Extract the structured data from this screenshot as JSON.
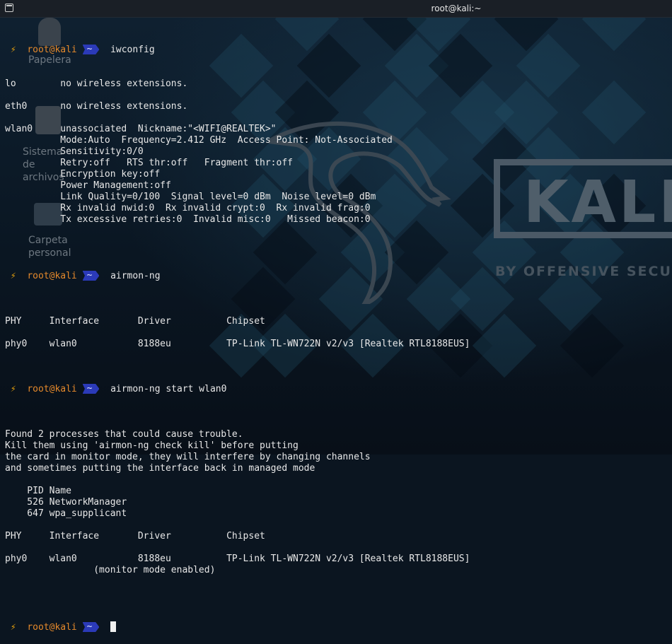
{
  "window": {
    "title": "root@kali:~",
    "icon": "terminal-icon"
  },
  "desktop": {
    "logo_text": "KALI",
    "logo_tagline": "BY OFFENSIVE SECURITY",
    "icons": [
      {
        "label": "Papelera",
        "icon": "trash-icon"
      },
      {
        "label": "Sistema de archivos",
        "icon": "drive-icon"
      },
      {
        "label": "Carpeta personal",
        "icon": "home-icon"
      }
    ]
  },
  "prompt": {
    "bolt": "⚡",
    "user": "root@kali",
    "cwd": "~"
  },
  "session": {
    "cmd1": "iwconfig",
    "iwconfig": [
      "lo        no wireless extensions.",
      "",
      "eth0      no wireless extensions.",
      "",
      "wlan0     unassociated  Nickname:\"<WIFI@REALTEK>\"",
      "          Mode:Auto  Frequency=2.412 GHz  Access Point: Not-Associated",
      "          Sensitivity:0/0",
      "          Retry:off   RTS thr:off   Fragment thr:off",
      "          Encryption key:off",
      "          Power Management:off",
      "          Link Quality=0/100  Signal level=0 dBm  Noise level=0 dBm",
      "          Rx invalid nwid:0  Rx invalid crypt:0  Rx invalid frag:0",
      "          Tx excessive retries:0  Invalid misc:0   Missed beacon:0",
      ""
    ],
    "cmd2": "airmon-ng",
    "airmon": [
      "",
      "PHY     Interface       Driver          Chipset",
      "",
      "phy0    wlan0           8188eu          TP-Link TL-WN722N v2/v3 [Realtek RTL8188EUS]"
    ],
    "cmd3": "airmon-ng start wlan0",
    "airmon_start": [
      "",
      "Found 2 processes that could cause trouble.",
      "Kill them using 'airmon-ng check kill' before putting",
      "the card in monitor mode, they will interfere by changing channels",
      "and sometimes putting the interface back in managed mode",
      "",
      "    PID Name",
      "    526 NetworkManager",
      "    647 wpa_supplicant",
      "",
      "PHY     Interface       Driver          Chipset",
      "",
      "phy0    wlan0           8188eu          TP-Link TL-WN722N v2/v3 [Realtek RTL8188EUS]",
      "                (monitor mode enabled)",
      ""
    ]
  }
}
